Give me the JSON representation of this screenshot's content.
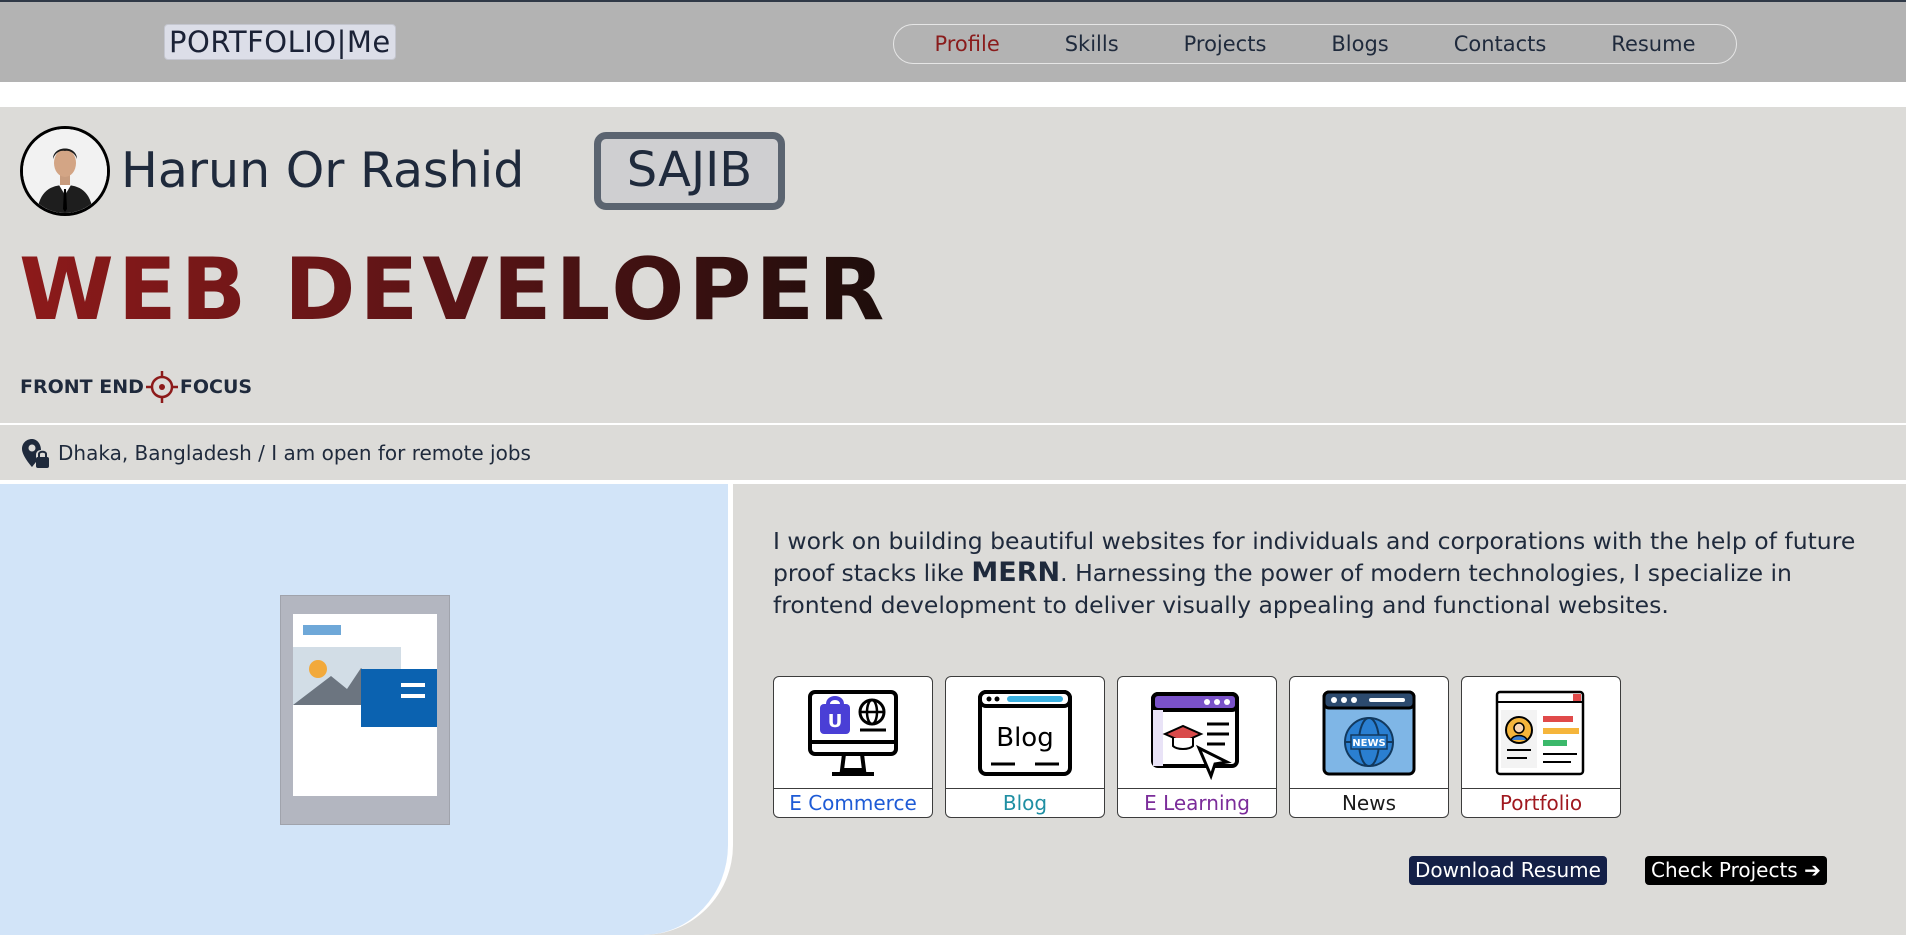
{
  "header": {
    "logo": "PORTFOLIO|Me",
    "nav": [
      "Profile",
      "Skills",
      "Projects",
      "Blogs",
      "Contacts",
      "Resume"
    ],
    "active_nav": "Profile"
  },
  "hero": {
    "name": "Harun Or Rashid",
    "nickname": "SAJIB",
    "role": "WEB DEVELOPER",
    "tagline_left": "FRONT END",
    "tagline_right": "FOCUS",
    "location": "Dhaka, Bangladesh / I am open for remote jobs"
  },
  "about": {
    "text_before": "I work on building beautiful websites for individuals and corporations with the help of future proof stacks like ",
    "highlight": "MERN",
    "text_after": ". Harnessing the power of modern technologies, I specialize in frontend development to deliver visually appealing and functional websites."
  },
  "project_cards": [
    {
      "label": "E Commerce",
      "icon": "ecommerce-icon",
      "color": "#1e5bd6"
    },
    {
      "label": "Blog",
      "icon": "blog-icon",
      "color": "#1f8fa3"
    },
    {
      "label": "E Learning",
      "icon": "elearning-icon",
      "color": "#7b2c9a"
    },
    {
      "label": "News",
      "icon": "news-icon",
      "color": "#1b1b1b"
    },
    {
      "label": "Portfolio",
      "icon": "portfolio-icon",
      "color": "#a0181f"
    }
  ],
  "buttons": {
    "download_resume": "Download Resume",
    "check_projects": "Check Projects ➔"
  },
  "colors": {
    "topbar": "#b3b3b3",
    "hero_bg": "#dcdbd8",
    "image_panel": "#d2e4f8",
    "accent_red": "#8d1a1a",
    "nav_active": "#8a1c1c"
  }
}
